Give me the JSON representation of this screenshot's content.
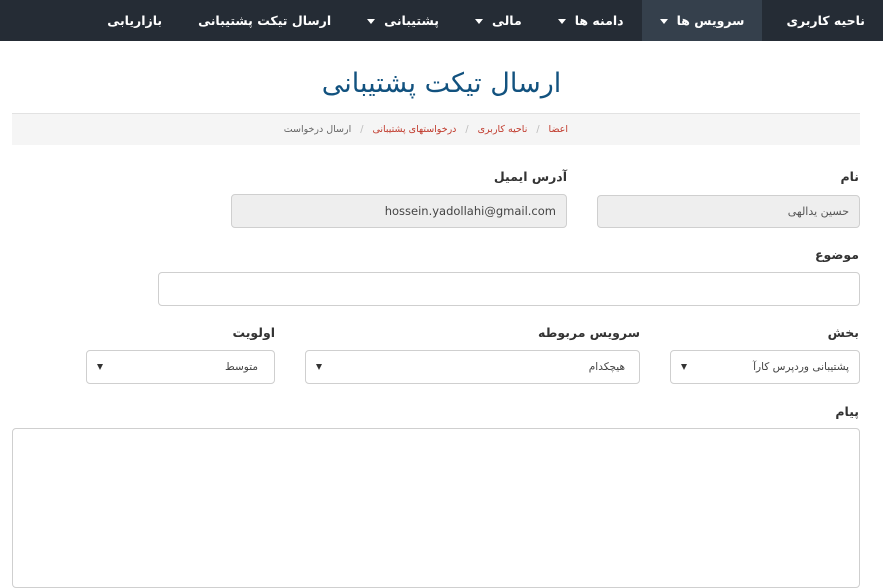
{
  "nav": {
    "items": [
      {
        "label": "ناحیه کاربری",
        "dropdown": false,
        "active": false
      },
      {
        "label": "سرویس ها",
        "dropdown": true,
        "active": true
      },
      {
        "label": "دامنه ها",
        "dropdown": true,
        "active": false
      },
      {
        "label": "مالی",
        "dropdown": true,
        "active": false
      },
      {
        "label": "پشتیبانی",
        "dropdown": true,
        "active": false
      },
      {
        "label": "ارسال تیکت پشتیبانی",
        "dropdown": false,
        "active": false
      },
      {
        "label": "بازاریابی",
        "dropdown": false,
        "active": false
      }
    ]
  },
  "page": {
    "title": "ارسال تیکت پشتیبانی"
  },
  "breadcrumb": {
    "items": [
      "اعضا",
      "ناحیه کاربری",
      "درخواستهای پشتیبانی",
      "ارسال درخواست"
    ]
  },
  "form": {
    "name_label": "نام",
    "name_value": "حسین یدالهی",
    "email_label": "آدرس ایمیل",
    "email_value": "hossein.yadollahi@gmail.com",
    "subject_label": "موضوع",
    "subject_value": "",
    "department_label": "بخش",
    "department_value": "پشتیبانی وردپرس کارآ",
    "related_service_label": "سرویس مربوطه",
    "related_service_value": "هیچکدام",
    "priority_label": "اولویت",
    "priority_value": "متوسط",
    "message_label": "پیام",
    "message_value": ""
  },
  "colors": {
    "navbar_bg": "#252c35",
    "navbar_active": "#35404c",
    "title": "#12527f",
    "link": "#c0392b"
  }
}
